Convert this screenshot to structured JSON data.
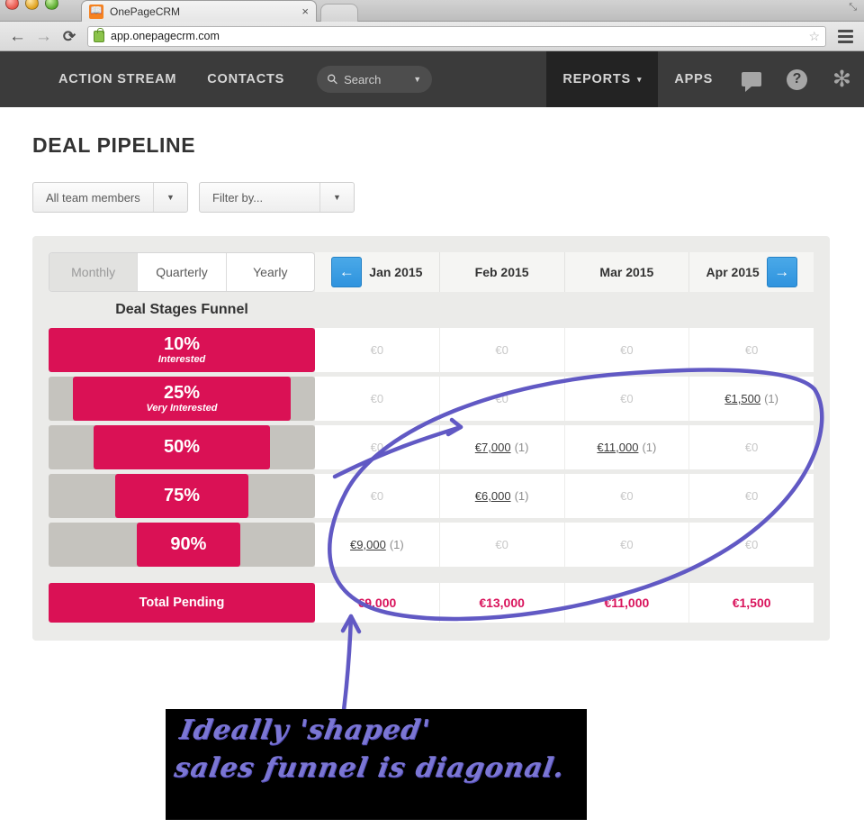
{
  "browser": {
    "tab_title": "OnePageCRM",
    "tab_favicon": "book-icon",
    "tab_close": "×",
    "back_icon": "←",
    "forward_icon": "→",
    "reload_icon": "⟳",
    "url": "app.onepagecrm.com",
    "lock_icon": "lock-icon",
    "star_icon": "☆",
    "minimize_icon": "⤡"
  },
  "appnav": {
    "links": [
      {
        "label": "ACTION STREAM"
      },
      {
        "label": "CONTACTS"
      }
    ],
    "search": {
      "label": "Search",
      "icon": "search-icon",
      "caret": "▼"
    },
    "right": [
      {
        "label": "REPORTS",
        "caret": "▾",
        "active": true
      },
      {
        "label": "APPS",
        "active": false
      }
    ],
    "icons": [
      {
        "name": "speech-bubble-icon"
      },
      {
        "name": "help-icon",
        "glyph": "?"
      },
      {
        "name": "gear-icon",
        "glyph": "✻"
      }
    ]
  },
  "page": {
    "title": "DEAL PIPELINE",
    "filters": [
      {
        "value": "All team members",
        "caret": "▼"
      },
      {
        "value": "Filter by...",
        "caret": "▼"
      }
    ]
  },
  "card": {
    "period_toggle": {
      "options": [
        "Monthly",
        "Quarterly",
        "Yearly"
      ],
      "selected": "Monthly"
    },
    "prev_icon": "←",
    "next_icon": "→",
    "funnel_heading": "Deal Stages Funnel",
    "total_label": "Total Pending",
    "zero_label": "€0"
  },
  "chart_data": {
    "type": "table",
    "title": "Deal Stages Funnel",
    "columns": [
      "Jan 2015",
      "Feb 2015",
      "Mar 2015",
      "Apr 2015"
    ],
    "stages": [
      {
        "percent": "10%",
        "label": "Interested",
        "bar_left_pct": 0,
        "bar_width_pct": 100
      },
      {
        "percent": "25%",
        "label": "Very Interested",
        "bar_left_pct": 9,
        "bar_width_pct": 82
      },
      {
        "percent": "50%",
        "label": "",
        "bar_left_pct": 17,
        "bar_width_pct": 66
      },
      {
        "percent": "75%",
        "label": "",
        "bar_left_pct": 25,
        "bar_width_pct": 50
      },
      {
        "percent": "90%",
        "label": "",
        "bar_left_pct": 33,
        "bar_width_pct": 39
      }
    ],
    "rows": [
      [
        {
          "amount": "€0",
          "count": ""
        },
        {
          "amount": "€0",
          "count": ""
        },
        {
          "amount": "€0",
          "count": ""
        },
        {
          "amount": "€0",
          "count": ""
        }
      ],
      [
        {
          "amount": "€0",
          "count": ""
        },
        {
          "amount": "€0",
          "count": ""
        },
        {
          "amount": "€0",
          "count": ""
        },
        {
          "amount": "€1,500",
          "count": "(1)"
        }
      ],
      [
        {
          "amount": "€0",
          "count": ""
        },
        {
          "amount": "€7,000",
          "count": "(1)"
        },
        {
          "amount": "€11,000",
          "count": "(1)"
        },
        {
          "amount": "€0",
          "count": ""
        }
      ],
      [
        {
          "amount": "€0",
          "count": ""
        },
        {
          "amount": "€6,000",
          "count": "(1)"
        },
        {
          "amount": "€0",
          "count": ""
        },
        {
          "amount": "€0",
          "count": ""
        }
      ],
      [
        {
          "amount": "€9,000",
          "count": "(1)"
        },
        {
          "amount": "€0",
          "count": ""
        },
        {
          "amount": "€0",
          "count": ""
        },
        {
          "amount": "€0",
          "count": ""
        }
      ]
    ],
    "totals": [
      "€9,000",
      "€13,000",
      "€11,000",
      "€1,500"
    ],
    "accent_color": "#da1155",
    "total_text_color": "#d9145c",
    "track_color": "#c5c3be"
  },
  "annotation": {
    "line1": "Ideally 'shaped'",
    "line2": "sales funnel is diagonal.",
    "ink_color": "#6159c4",
    "background": "#000000"
  }
}
